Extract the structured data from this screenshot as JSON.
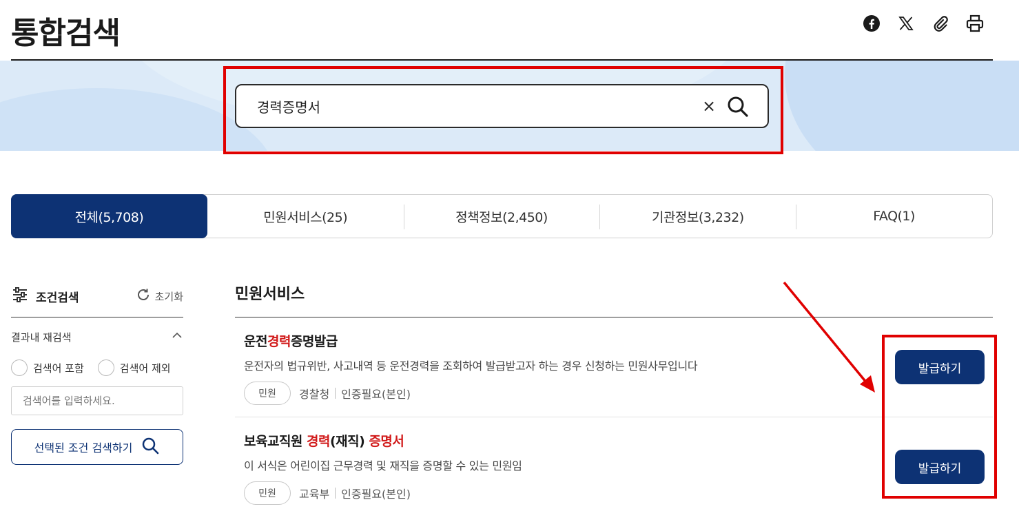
{
  "header": {
    "title": "통합검색",
    "share_icons": [
      "facebook-icon",
      "x-icon",
      "link-icon",
      "print-icon"
    ]
  },
  "search": {
    "value": "경력증명서",
    "clear_symbol": "×"
  },
  "tabs": [
    {
      "label": "전체(5,708)",
      "active": true
    },
    {
      "label": "민원서비스(25)",
      "active": false
    },
    {
      "label": "정책정보(2,450)",
      "active": false
    },
    {
      "label": "기관정보(3,232)",
      "active": false
    },
    {
      "label": "FAQ(1)",
      "active": false
    }
  ],
  "sidebar": {
    "filter_title": "조건검색",
    "reset_label": "초기화",
    "refine_label": "결과내 재검색",
    "include_label": "검색어 포함",
    "exclude_label": "검색어 제외",
    "input_placeholder": "검색어를 입력하세요.",
    "search_button_label": "선택된 조건 검색하기"
  },
  "results": {
    "section_title": "민원서비스",
    "items": [
      {
        "title_pre": "운전",
        "title_hl": "경력",
        "title_post": "증명발급",
        "description": "운전자의 법규위반, 사고내역 등 운전경력을 조회하여 발급받고자 하는 경우 신청하는 민원사무입니다",
        "chip": "민원",
        "agency": "경찰청",
        "auth": "인증필요(본인)",
        "button_label": "발급하기"
      },
      {
        "title_pre": "보육교직원 ",
        "title_hl": "경력",
        "title_mid": "(재직) ",
        "title_hl2": "증명서",
        "description": "이 서식은 어린이집 근무경력 및 재직을 증명할 수 있는 민원임",
        "chip": "민원",
        "agency": "교육부",
        "auth": "인증필요(본인)",
        "button_label": "발급하기"
      }
    ]
  },
  "colors": {
    "primary": "#0d3274",
    "highlight": "#d11a1a",
    "annotation": "#e00000",
    "band": "#dceaf8"
  }
}
